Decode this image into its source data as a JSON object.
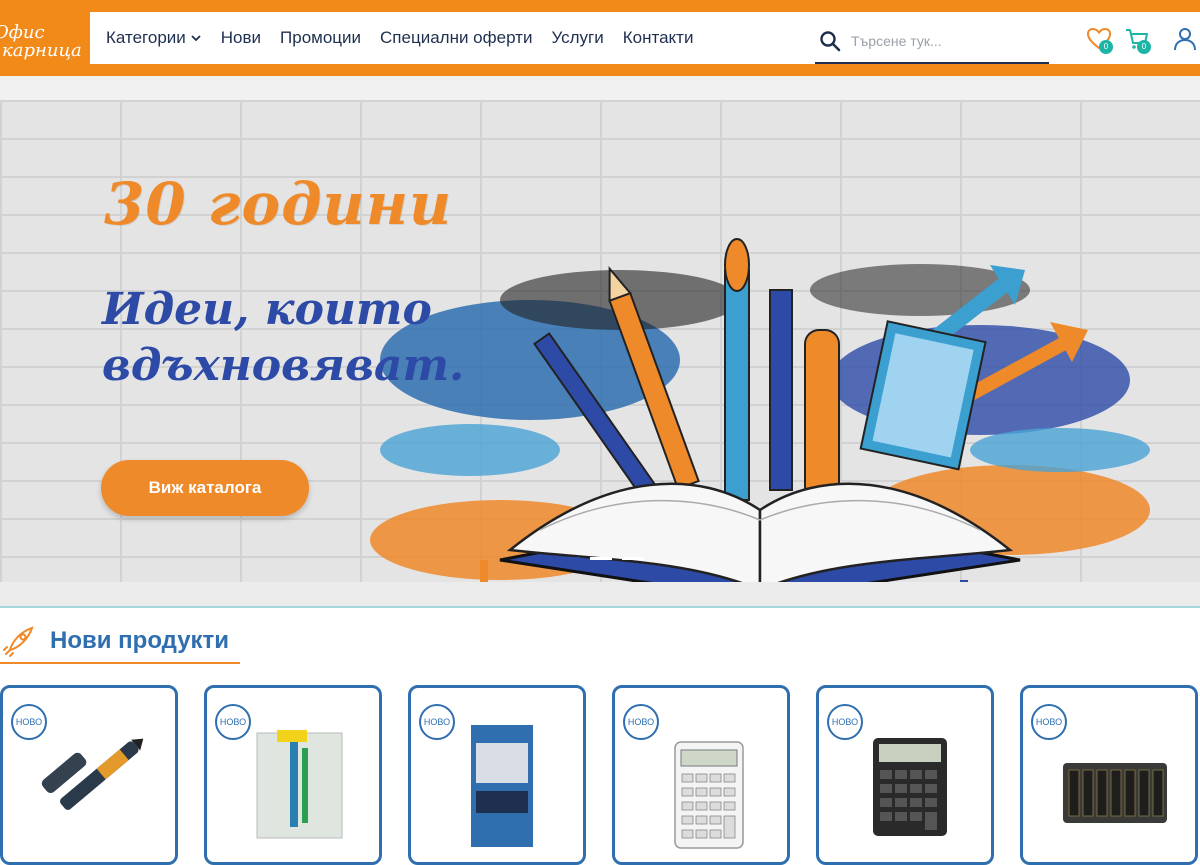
{
  "header": {
    "logo_line1": "Офис",
    "logo_line2": "карница",
    "nav": [
      {
        "label": "Категории",
        "has_dropdown": true
      },
      {
        "label": "Нови"
      },
      {
        "label": "Промоции"
      },
      {
        "label": "Специални оферти"
      },
      {
        "label": "Услуги"
      },
      {
        "label": "Контакти"
      }
    ],
    "search_placeholder": "Търсене тук...",
    "wishlist_count": "0",
    "cart_count": "0"
  },
  "hero": {
    "title": "30 години",
    "subtitle": "Идеи, които вдъхновяват.",
    "button": "Виж каталога",
    "slides": 3,
    "active_slide": 1
  },
  "section": {
    "title": "Нови продукти"
  },
  "products": [
    {
      "badge": "НОВО",
      "icon": "marker-pen"
    },
    {
      "badge": "НОВО",
      "icon": "pen-blister"
    },
    {
      "badge": "НОВО",
      "icon": "cash-book"
    },
    {
      "badge": "НОВО",
      "icon": "calculator-white"
    },
    {
      "badge": "НОВО",
      "icon": "calculator-black"
    },
    {
      "badge": "НОВО",
      "icon": "coin-tray"
    }
  ],
  "colors": {
    "accent": "#f28a1a",
    "brand_blue": "#2f6fb0",
    "dark_navy": "#1e2f4f",
    "badge_teal": "#1cb5a6"
  }
}
